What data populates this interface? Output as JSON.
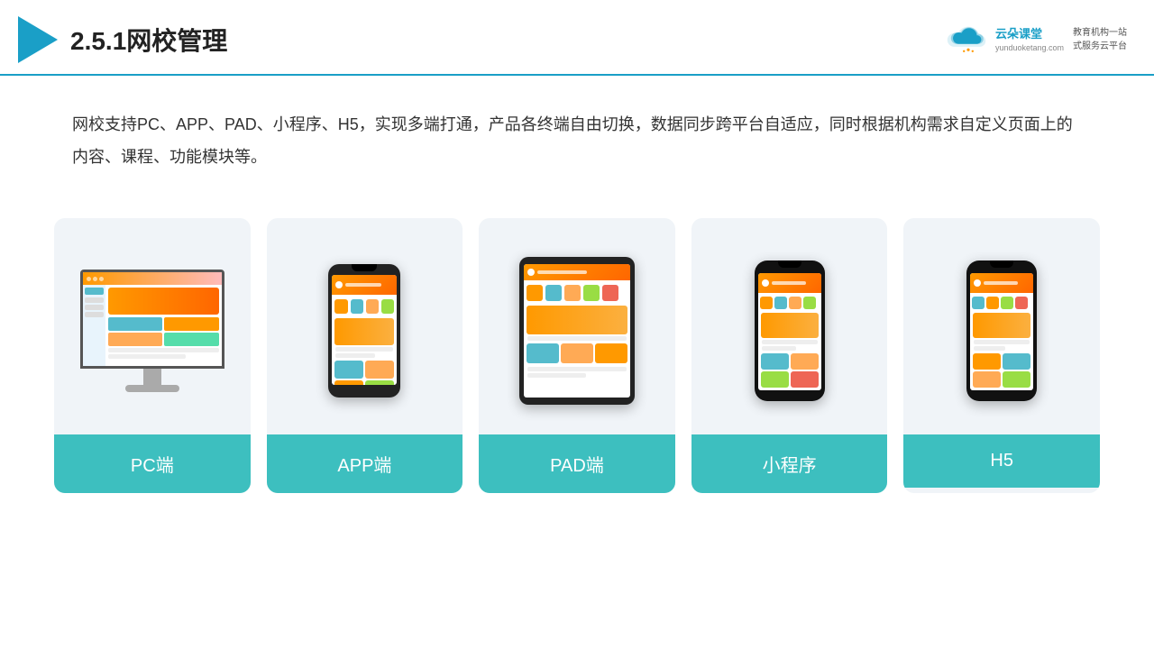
{
  "header": {
    "title": "2.5.1网校管理",
    "brand": {
      "name": "云朵课堂",
      "domain": "yunduoketang.com",
      "tagline1": "教育机构一站",
      "tagline2": "式服务云平台"
    }
  },
  "description": {
    "text": "网校支持PC、APP、PAD、小程序、H5，实现多端打通，产品各终端自由切换，数据同步跨平台自适应，同时根据机构需求自定义页面上的内容、课程、功能模块等。"
  },
  "cards": [
    {
      "id": "pc",
      "label": "PC端"
    },
    {
      "id": "app",
      "label": "APP端"
    },
    {
      "id": "pad",
      "label": "PAD端"
    },
    {
      "id": "miniprogram",
      "label": "小程序"
    },
    {
      "id": "h5",
      "label": "H5"
    }
  ],
  "colors": {
    "accent": "#1a9fc7",
    "teal": "#3dbfbf",
    "orange": "#f90",
    "dark": "#222"
  }
}
